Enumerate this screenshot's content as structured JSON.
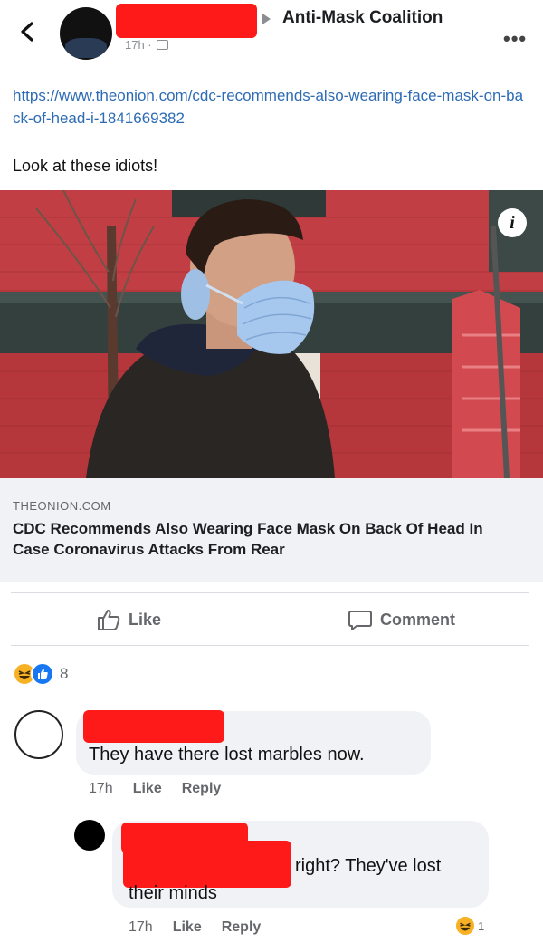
{
  "header": {
    "back_icon": "chevron-left-icon",
    "group_name": "Anti-Mask Coalition",
    "time": "17h ·",
    "more_icon": "ellipsis-icon",
    "more_label": "•••"
  },
  "post": {
    "link": "https://www.theonion.com/cdc-recommends-also-wearing-face-mask-on-back-of-head-i-1841669382",
    "text": "Look at these idiots!",
    "info_label": "i"
  },
  "link_card": {
    "domain": "THEONION.COM",
    "title": "CDC Recommends Also Wearing Face Mask On Back Of Head In Case Coronavirus Attacks From Rear"
  },
  "actions": {
    "like_label": "Like",
    "comment_label": "Comment"
  },
  "reactions": {
    "count": "8",
    "types": [
      "haha",
      "like"
    ]
  },
  "comments": [
    {
      "text": "They have there lost marbles now.",
      "time": "17h",
      "like_label": "Like",
      "reply_label": "Reply"
    },
    {
      "text_part1": "right? They've lost",
      "text_part2": "their minds",
      "time": "17h",
      "like_label": "Like",
      "reply_label": "Reply",
      "reaction_count": "1"
    }
  ],
  "colors": {
    "link": "#2d6bb5",
    "redaction": "#ff1a1a",
    "bubble": "#f0f2f5",
    "muted": "#65676b"
  }
}
